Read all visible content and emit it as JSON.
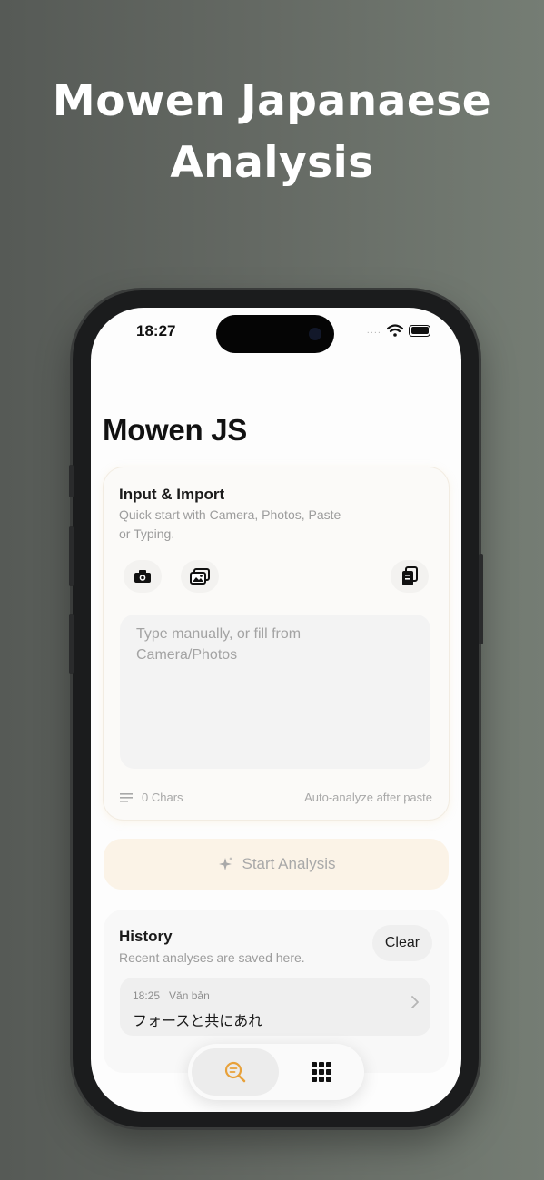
{
  "headline": {
    "line1": "Mowen Japanaese",
    "line2": "Analysis"
  },
  "status": {
    "time": "18:27",
    "signal_dots": "....",
    "icons": [
      "wifi-icon",
      "battery-icon"
    ]
  },
  "app": {
    "title": "Mowen JS"
  },
  "input_card": {
    "title": "Input & Import",
    "subtitle_line1": "Quick start with Camera, Photos, Paste",
    "subtitle_line2": "or Typing.",
    "buttons": [
      "camera-icon",
      "photos-icon",
      "paste-icon"
    ],
    "placeholder_line1": "Type manually, or fill from",
    "placeholder_line2": "Camera/Photos",
    "char_count": "0 Chars",
    "auto_hint": "Auto-analyze after paste"
  },
  "start_button": {
    "label": "Start Analysis",
    "icon": "sparkle-icon"
  },
  "history": {
    "title": "History",
    "subtitle": "Recent analyses are saved here.",
    "clear_label": "Clear",
    "items": [
      {
        "time": "18:25",
        "type": "Văn bản",
        "text": "フォースと共にあれ"
      }
    ]
  },
  "tabbar": {
    "tabs": [
      "analysis-tab",
      "apps-tab"
    ],
    "active": "analysis-tab"
  },
  "colors": {
    "accent": "#e8a13a",
    "background_start": "#565a56",
    "background_end": "#757d74"
  }
}
